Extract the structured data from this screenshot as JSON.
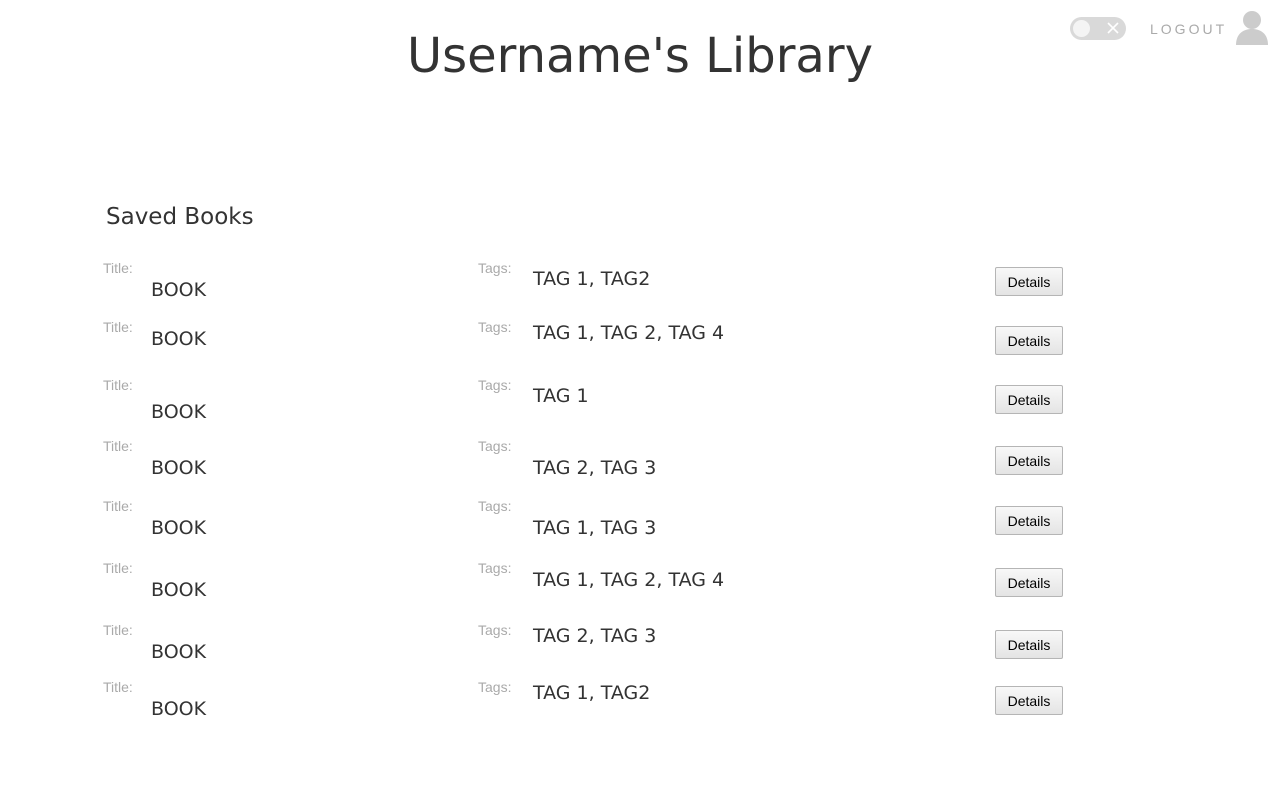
{
  "header": {
    "title": "Username's Library",
    "logout_label": "LOGOUT",
    "theme_toggle": {
      "state": "off",
      "icon": "close-icon"
    },
    "avatar_icon": "user-avatar-icon"
  },
  "main": {
    "section_title": "Saved Books",
    "title_label": "Title:",
    "tags_label": "Tags:",
    "details_label": "Details",
    "books": [
      {
        "title": "BOOK",
        "tags": "TAG 1, TAG2"
      },
      {
        "title": "BOOK",
        "tags": "TAG 1, TAG 2, TAG 4"
      },
      {
        "title": "BOOK",
        "tags": "TAG 1"
      },
      {
        "title": "BOOK",
        "tags": "TAG 2, TAG 3"
      },
      {
        "title": "BOOK",
        "tags": "TAG 1, TAG 3"
      },
      {
        "title": "BOOK",
        "tags": "TAG 1, TAG 2, TAG 4"
      },
      {
        "title": "BOOK",
        "tags": "TAG 2, TAG 3"
      },
      {
        "title": "BOOK",
        "tags": "TAG 1, TAG2"
      }
    ]
  },
  "colors": {
    "text": "#333333",
    "label": "#aaaaaa",
    "toggle_track": "#d9d9d9",
    "avatar": "#cccccc"
  }
}
